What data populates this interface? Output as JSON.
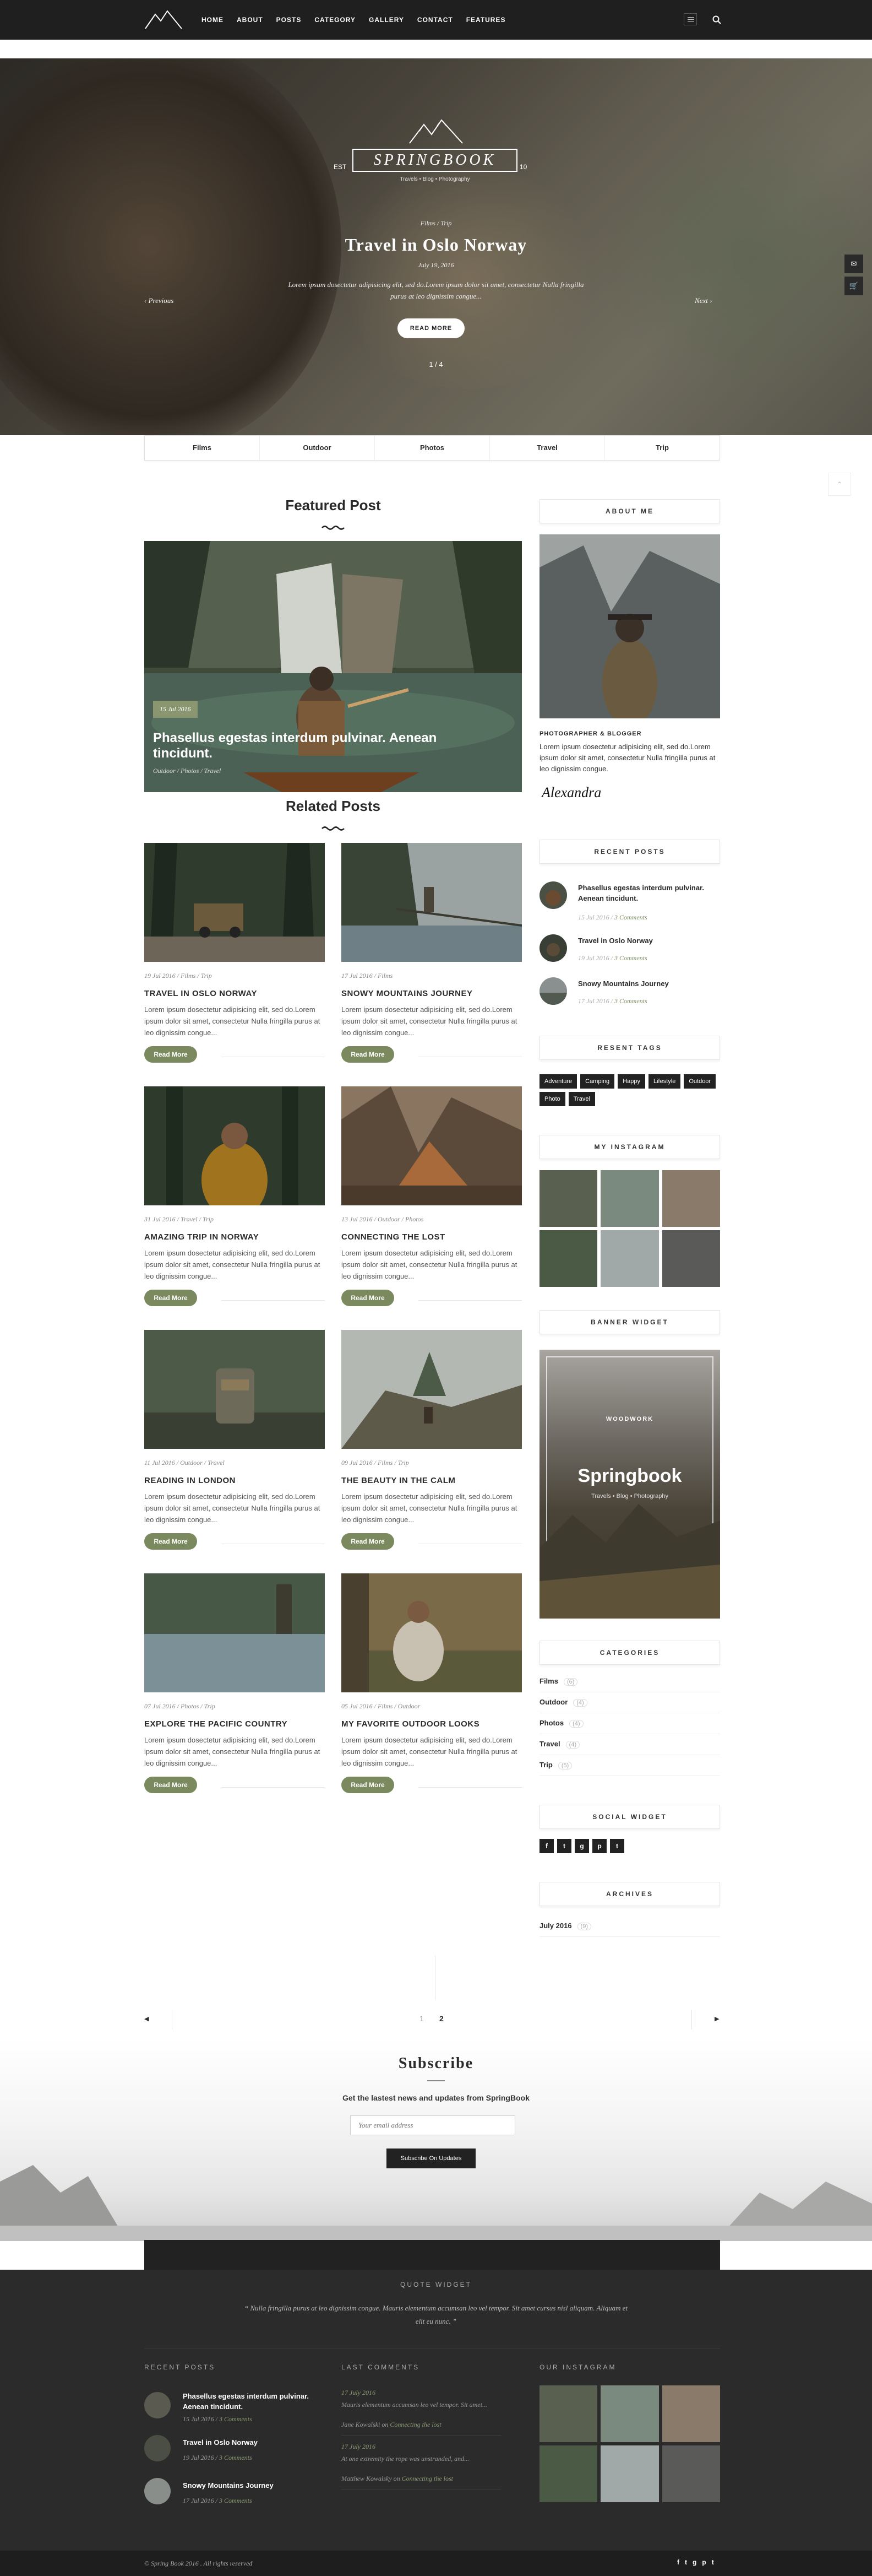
{
  "nav": {
    "items": [
      "HOME",
      "ABOUT",
      "POSTS",
      "CATEGORY",
      "GALLERY",
      "CONTACT",
      "FEATURES"
    ]
  },
  "hero": {
    "est_left": "EST",
    "est_right": "10",
    "brand": "SPRINGBOOK",
    "tagline": "Travels • Blog • Photography",
    "categories": "Films  /  Trip",
    "title": "Travel in Oslo Norway",
    "date": "July 19, 2016",
    "description": "Lorem ipsum dosectetur adipisicing elit, sed do.Lorem ipsum dolor sit amet, consectetur Nulla fringilla purus at leo dignissim congue...",
    "button": "READ MORE",
    "prev": "Previous",
    "next": "Next",
    "pager": "1 / 4"
  },
  "cat_bar": [
    "Films",
    "Outdoor",
    "Photos",
    "Travel",
    "Trip"
  ],
  "featured": {
    "heading": "Featured Post",
    "date": "15 Jul 2016",
    "title": "Phasellus egestas interdum pulvinar. Aenean tincidunt.",
    "meta": "Outdoor  /  Photos  /  Travel"
  },
  "related": {
    "heading": "Related Posts",
    "read_more": "Read More",
    "posts": [
      {
        "date": "19 Jul 2016",
        "cats": "Films  /  Trip",
        "title": "TRAVEL IN OSLO NORWAY",
        "excerpt": "Lorem ipsum dosectetur adipisicing elit, sed do.Lorem ipsum dolor sit amet, consectetur Nulla fringilla purus at leo dignissim congue..."
      },
      {
        "date": "17 Jul 2016",
        "cats": "Films",
        "title": "SNOWY MOUNTAINS JOURNEY",
        "excerpt": "Lorem ipsum dosectetur adipisicing elit, sed do.Lorem ipsum dolor sit amet, consectetur Nulla fringilla purus at leo dignissim congue..."
      },
      {
        "date": "31 Jul 2016",
        "cats": "Travel  /  Trip",
        "title": "AMAZING TRIP IN NORWAY",
        "excerpt": "Lorem ipsum dosectetur adipisicing elit, sed do.Lorem ipsum dolor sit amet, consectetur Nulla fringilla purus at leo dignissim congue..."
      },
      {
        "date": "13 Jul 2016",
        "cats": "Outdoor  /  Photos",
        "title": "CONNECTING THE LOST",
        "excerpt": "Lorem ipsum dosectetur adipisicing elit, sed do.Lorem ipsum dolor sit amet, consectetur Nulla fringilla purus at leo dignissim congue..."
      },
      {
        "date": "11 Jul 2016",
        "cats": "Outdoor  /  Travel",
        "title": "READING IN LONDON",
        "excerpt": "Lorem ipsum dosectetur adipisicing elit, sed do.Lorem ipsum dolor sit amet, consectetur Nulla fringilla purus at leo dignissim congue..."
      },
      {
        "date": "09 Jul 2016",
        "cats": "Films  /  Trip",
        "title": "THE BEAUTY IN THE CALM",
        "excerpt": "Lorem ipsum dosectetur adipisicing elit, sed do.Lorem ipsum dolor sit amet, consectetur Nulla fringilla purus at leo dignissim congue..."
      },
      {
        "date": "07 Jul 2016",
        "cats": "Photos  /  Trip",
        "title": "EXPLORE THE PACIFIC COUNTRY",
        "excerpt": "Lorem ipsum dosectetur adipisicing elit, sed do.Lorem ipsum dolor sit amet, consectetur Nulla fringilla purus at leo dignissim congue..."
      },
      {
        "date": "05 Jul 2016",
        "cats": "Films  /  Outdoor",
        "title": "MY FAVORITE OUTDOOR LOOKS",
        "excerpt": "Lorem ipsum dosectetur adipisicing elit, sed do.Lorem ipsum dolor sit amet, consectetur Nulla fringilla purus at leo dignissim congue..."
      }
    ]
  },
  "sidebar": {
    "about": {
      "heading": "ABOUT ME",
      "role": "PHOTOGRAPHER & BLOGGER",
      "text": "Lorem ipsum dosectetur adipisicing elit, sed do.Lorem ipsum dolor sit amet, consectetur Nulla fringilla purus at leo dignissim congue.",
      "signature": "Alexandra"
    },
    "recent": {
      "heading": "RECENT POSTS",
      "items": [
        {
          "title": "Phasellus egestas interdum pulvinar. Aenean tincidunt.",
          "date": "15 Jul 2016",
          "comments": "3 Comments"
        },
        {
          "title": "Travel in Oslo Norway",
          "date": "19 Jul 2016",
          "comments": "3 Comments"
        },
        {
          "title": "Snowy Mountains Journey",
          "date": "17 Jul 2016",
          "comments": "3 Comments"
        }
      ]
    },
    "tags": {
      "heading": "RESENT TAGS",
      "items": [
        "Adventure",
        "Camping",
        "Happy",
        "Lifestyle",
        "Outdoor",
        "Photo",
        "Travel"
      ]
    },
    "instagram": {
      "heading": "MY INSTAGRAM"
    },
    "banner": {
      "heading": "BANNER WIDGET",
      "title": "Springbook",
      "subtitle": "Travels • Blog • Photography",
      "badge": "WOODWORK"
    },
    "categories": {
      "heading": "CATEGORIES",
      "items": [
        {
          "name": "Films",
          "count": "(6)"
        },
        {
          "name": "Outdoor",
          "count": "(4)"
        },
        {
          "name": "Photos",
          "count": "(4)"
        },
        {
          "name": "Travel",
          "count": "(4)"
        },
        {
          "name": "Trip",
          "count": "(5)"
        }
      ]
    },
    "social": {
      "heading": "SOCIAL WIDGET",
      "icons": [
        "f",
        "t",
        "g",
        "p",
        "t"
      ]
    },
    "archives": {
      "heading": "ARCHIVES",
      "items": [
        {
          "name": "July 2016",
          "count": "(9)"
        }
      ]
    }
  },
  "pagination": {
    "prev": "◀",
    "next": "▶",
    "pages": [
      "1",
      "2"
    ]
  },
  "subscribe": {
    "title": "Subscribe",
    "subtitle": "Get the lastest news and updates from SpringBook",
    "placeholder": "Your email address",
    "button": "Subscribe On Updates"
  },
  "footer": {
    "quote_heading": "QUOTE WIDGET",
    "quote": "“ Nulla fringilla purus at leo dignissim congue. Mauris elementum accumsan leo vel tempor. Sit amet cursus nisl aliquam. Aliquam et elit eu nunc. ”",
    "recent_heading": "RECENT POSTS",
    "recent": [
      {
        "title": "Phasellus egestas interdum pulvinar. Aenean tincidunt.",
        "date": "15 Jul 2016",
        "comments": "3 Comments"
      },
      {
        "title": "Travel in Oslo Norway",
        "date": "19 Jul 2016",
        "comments": "3 Comments"
      },
      {
        "title": "Snowy Mountains Journey",
        "date": "17 Jul 2016",
        "comments": "3 Comments"
      }
    ],
    "comments_heading": "LAST COMMENTS",
    "comments": [
      {
        "date": "17 July 2016",
        "text": "Mauris elementum accumsan leo vel tempor. Sit amet...",
        "author": "Jane Kowalski",
        "on": "on",
        "post": "Connecting the lost"
      },
      {
        "date": "17 July 2016",
        "text": "At one extremity the rope was unstranded, and...",
        "author": "Matthew Kowalsky",
        "on": "on",
        "post": "Connecting the lost"
      }
    ],
    "insta_heading": "OUR INSTAGRAM",
    "copyright": "© Spring Book 2016 . All rights reserved",
    "social": [
      "f",
      "t",
      "g",
      "p",
      "t"
    ]
  }
}
